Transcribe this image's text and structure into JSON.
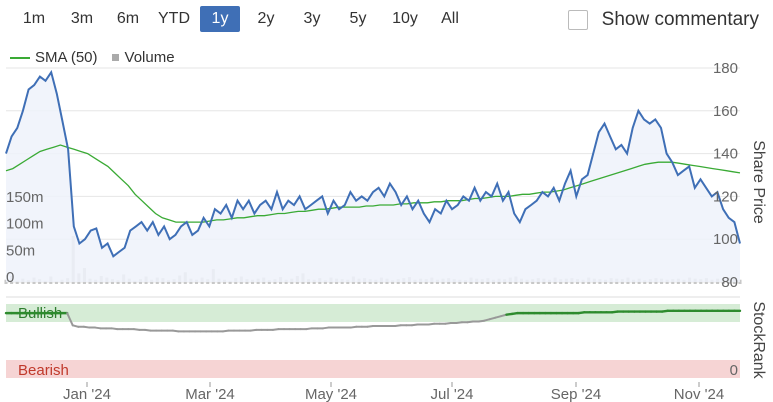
{
  "ranges": [
    "1m",
    "3m",
    "6m",
    "YTD",
    "1y",
    "2y",
    "3y",
    "5y",
    "10y",
    "All"
  ],
  "active_range": "1y",
  "commentary": {
    "label": "Show commentary",
    "checked": false
  },
  "legend": {
    "sma": "SMA (50)",
    "volume": "Volume"
  },
  "colors": {
    "price": "#3f6fb6",
    "sma": "#3aaa35",
    "volume": "#c8c8c8",
    "stockrank": "#999999",
    "stockrank_bull": "#2e8b2e",
    "bull_band": "#d6ecd6",
    "bear_band": "#f6d4d4",
    "active": "#3f6fb6"
  },
  "chart_data": [
    {
      "type": "line",
      "title": "",
      "ylabel": "Share Price",
      "ylim": [
        80,
        180
      ],
      "yticks": [
        "80",
        "100",
        "120",
        "140",
        "160",
        "180"
      ],
      "xticks": [
        "Jan '24",
        "Mar '24",
        "May '24",
        "Jul '24",
        "Sep '24",
        "Nov '24"
      ],
      "volume_ticks": [
        "0",
        "50m",
        "100m",
        "150m"
      ],
      "volume_ylim": [
        0,
        180
      ],
      "series": [
        {
          "name": "Share Price",
          "values": [
            140,
            148,
            152,
            160,
            170,
            172,
            176,
            174,
            178,
            168,
            155,
            142,
            106,
            98,
            100,
            104,
            105,
            96,
            98,
            92,
            94,
            96,
            104,
            106,
            108,
            104,
            108,
            102,
            106,
            100,
            102,
            106,
            108,
            102,
            104,
            110,
            106,
            114,
            112,
            116,
            110,
            118,
            114,
            118,
            112,
            116,
            118,
            114,
            122,
            114,
            118,
            116,
            120,
            114,
            116,
            118,
            120,
            112,
            118,
            114,
            116,
            122,
            118,
            120,
            118,
            122,
            124,
            120,
            126,
            122,
            116,
            120,
            114,
            118,
            112,
            108,
            114,
            112,
            118,
            114,
            116,
            120,
            118,
            124,
            118,
            122,
            120,
            126,
            118,
            122,
            112,
            108,
            114,
            116,
            118,
            122,
            120,
            124,
            118,
            126,
            132,
            120,
            128,
            130,
            140,
            150,
            154,
            148,
            142,
            144,
            140,
            152,
            160,
            156,
            154,
            156,
            152,
            140,
            136,
            130,
            132,
            134,
            124,
            128,
            124,
            120,
            122,
            114,
            110,
            108,
            98
          ]
        },
        {
          "name": "SMA (50)",
          "values": [
            132,
            133,
            135,
            137,
            139,
            141,
            142,
            143,
            144,
            143,
            142,
            141,
            140,
            138,
            136,
            134,
            131,
            128,
            125,
            121,
            118,
            115,
            112,
            110,
            109,
            108,
            108,
            108,
            108,
            108,
            108.5,
            109,
            109,
            109.5,
            110,
            110,
            110.5,
            111,
            111,
            111.5,
            112,
            112,
            112.5,
            113,
            113,
            113.5,
            114,
            114,
            114.5,
            115,
            115,
            115,
            115,
            115.5,
            115.5,
            116,
            116,
            116,
            116.5,
            116.5,
            117,
            117,
            117,
            117.5,
            117.5,
            118,
            118,
            118,
            118.5,
            119,
            119,
            119.5,
            120,
            120,
            120,
            120.5,
            121,
            121,
            121.5,
            122,
            122,
            122.5,
            123,
            124,
            125,
            126,
            127,
            128,
            129,
            130,
            131,
            132,
            133,
            134,
            135,
            135.5,
            136,
            136,
            136,
            135.5,
            135,
            134.5,
            134,
            133.5,
            133,
            132.5,
            132,
            131.5,
            131
          ]
        },
        {
          "name": "Volume",
          "values": [
            8,
            15,
            6,
            10,
            7,
            12,
            9,
            6,
            14,
            5,
            8,
            11,
            90,
            20,
            30,
            10,
            8,
            15,
            12,
            9,
            7,
            18,
            10,
            6,
            9,
            14,
            8,
            12,
            11,
            7,
            9,
            16,
            22,
            10,
            8,
            12,
            9,
            28,
            10,
            8,
            6,
            11,
            14,
            9,
            8,
            10,
            12,
            7,
            9,
            13,
            8,
            10,
            15,
            20,
            9,
            8,
            11,
            7,
            12,
            10,
            9,
            8,
            14,
            10,
            11,
            9,
            8,
            12,
            10,
            7,
            9,
            11,
            13,
            8,
            10,
            9,
            12,
            8,
            10,
            11,
            9,
            8,
            7,
            12,
            10,
            9,
            11,
            8,
            10,
            9,
            12,
            14,
            10,
            8,
            9,
            11,
            10,
            8,
            12,
            9,
            10,
            11,
            9,
            8,
            12,
            10,
            9,
            8,
            11,
            10,
            9,
            12,
            8,
            10,
            7,
            9,
            11,
            10,
            8,
            9,
            10,
            8,
            12,
            10,
            9,
            11,
            8,
            10,
            9,
            12,
            10,
            8
          ]
        }
      ]
    },
    {
      "type": "line",
      "title": "",
      "ylabel": "StockRank",
      "ylim": [
        0,
        100
      ],
      "yticks": [
        "0"
      ],
      "band_labels": {
        "bull": "Bullish",
        "bear": "Bearish"
      },
      "series": [
        {
          "name": "StockRank",
          "values": [
            88,
            88,
            88,
            88,
            88,
            88,
            88,
            88,
            88,
            88,
            88,
            88,
            72,
            70,
            70,
            69,
            69,
            68,
            68,
            68,
            67,
            67,
            67,
            67,
            66,
            66,
            65,
            65,
            65,
            65,
            65,
            64,
            64,
            64,
            64,
            64,
            64,
            64,
            64,
            64,
            65,
            65,
            65,
            65,
            65,
            66,
            66,
            66,
            66,
            67,
            67,
            67,
            67,
            67,
            67,
            68,
            68,
            68,
            69,
            69,
            69,
            69,
            69,
            70,
            70,
            70,
            71,
            71,
            71,
            71,
            71,
            72,
            72,
            72,
            73,
            73,
            73,
            74,
            74,
            74,
            75,
            75,
            76,
            76,
            77,
            77,
            78,
            80,
            82,
            84,
            86,
            87,
            88,
            88,
            88,
            88,
            88,
            88,
            88,
            88,
            88,
            88,
            88,
            88,
            89,
            89,
            89,
            89,
            89,
            89,
            90,
            90,
            90,
            90,
            90,
            90,
            90,
            90,
            90,
            91,
            91,
            91,
            91,
            91,
            91,
            91,
            91,
            91,
            91,
            91,
            91,
            91,
            91
          ]
        }
      ]
    }
  ]
}
